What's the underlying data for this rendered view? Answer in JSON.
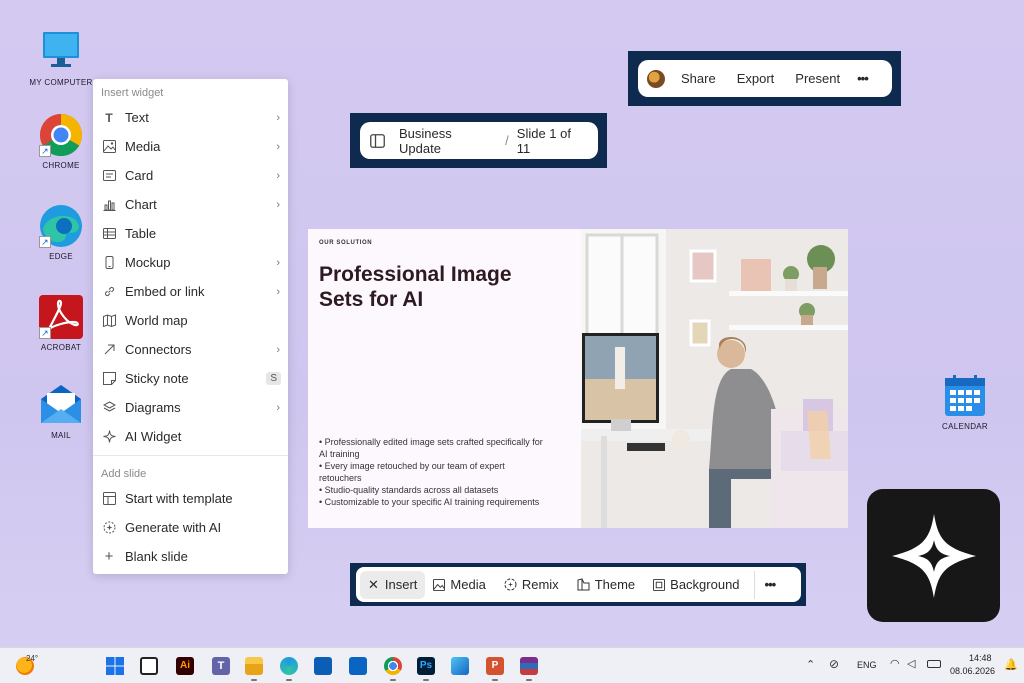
{
  "desktop": {
    "icons": [
      {
        "label": "MY COMPUTER"
      },
      {
        "label": "CHROME"
      },
      {
        "label": "EDGE"
      },
      {
        "label": "ACROBAT"
      },
      {
        "label": "MAIL"
      },
      {
        "label": "CALENDAR"
      }
    ]
  },
  "insert_menu": {
    "widget_title": "Insert widget",
    "widget_items": [
      {
        "label": "Text",
        "icon": "text-icon",
        "submenu": true
      },
      {
        "label": "Media",
        "icon": "image-icon",
        "submenu": true
      },
      {
        "label": "Card",
        "icon": "card-icon",
        "submenu": true
      },
      {
        "label": "Chart",
        "icon": "bar-chart-icon",
        "submenu": true
      },
      {
        "label": "Table",
        "icon": "table-icon",
        "submenu": false
      },
      {
        "label": "Mockup",
        "icon": "phone-icon",
        "submenu": true
      },
      {
        "label": "Embed or link",
        "icon": "link-icon",
        "submenu": true
      },
      {
        "label": "World map",
        "icon": "map-icon",
        "submenu": false
      },
      {
        "label": "Connectors",
        "icon": "arrow-icon",
        "submenu": true
      },
      {
        "label": "Sticky note",
        "icon": "sticky-note-icon",
        "shortcut": "S"
      },
      {
        "label": "Diagrams",
        "icon": "layers-icon",
        "submenu": true
      },
      {
        "label": "AI Widget",
        "icon": "sparkle-icon",
        "submenu": false
      }
    ],
    "slide_title": "Add slide",
    "slide_items": [
      {
        "label": "Start with template",
        "icon": "template-icon"
      },
      {
        "label": "Generate with AI",
        "icon": "ai-icon"
      },
      {
        "label": "Blank slide",
        "icon": "plus-icon"
      }
    ]
  },
  "breadcrumb": {
    "deck": "Business Update",
    "separator": "/",
    "slide": "Slide 1 of 11"
  },
  "top_toolbar": {
    "share": "Share",
    "export": "Export",
    "present": "Present",
    "more": "•••"
  },
  "slide": {
    "kicker": "OUR SOLUTION",
    "heading_line1": "Professional Image",
    "heading_line2": "Sets for AI",
    "bullets": [
      "• Professionally edited image sets crafted specifically for AI training",
      "• Every image retouched by our team of expert retouchers",
      "• Studio-quality standards across all datasets",
      "• Customizable to your specific AI training requirements"
    ]
  },
  "bottom_toolbar": {
    "insert": "Insert",
    "media": "Media",
    "remix": "Remix",
    "theme": "Theme",
    "background": "Background",
    "more": "•••"
  },
  "taskbar": {
    "weather": "24°",
    "language": "ENG",
    "time": "14:48",
    "date": "08.06.2026"
  },
  "colors": {
    "navy": "#0f2a4f",
    "desktop_bg": "#d3c9f1"
  }
}
